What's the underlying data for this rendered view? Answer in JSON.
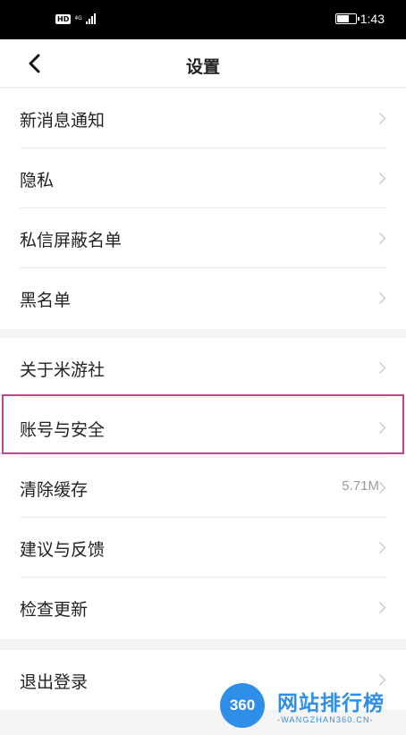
{
  "status_bar": {
    "hd": "HD",
    "network": "4G",
    "time": "1:43",
    "battery_level": 0.7
  },
  "nav": {
    "title": "设置"
  },
  "groups": [
    {
      "rows": [
        {
          "label": "新消息通知"
        },
        {
          "label": "隐私"
        },
        {
          "label": "私信屏蔽名单"
        },
        {
          "label": "黑名单"
        }
      ]
    },
    {
      "rows": [
        {
          "label": "关于米游社"
        },
        {
          "label": "账号与安全"
        },
        {
          "label": "清除缓存",
          "value": "5.71M"
        },
        {
          "label": "建议与反馈"
        },
        {
          "label": "检查更新"
        }
      ]
    },
    {
      "rows": [
        {
          "label": "退出登录"
        }
      ]
    }
  ],
  "watermark": {
    "logo_text": "360",
    "title": "网站排行榜",
    "subtitle": "-WANGZHAN360.CN-"
  },
  "colors": {
    "highlight": "#c2468f",
    "brand": "#2f8ee8"
  }
}
